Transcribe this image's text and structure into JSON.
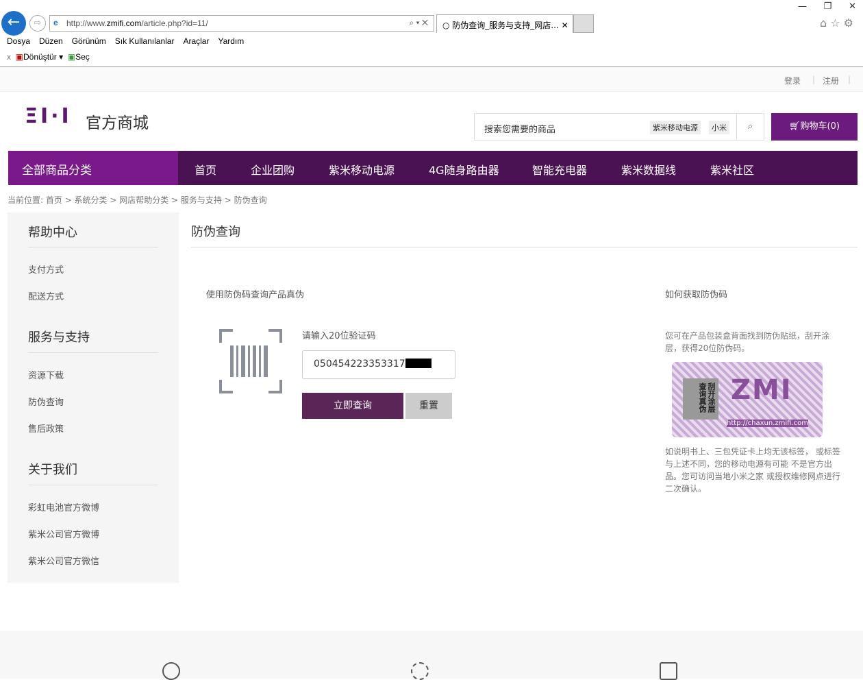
{
  "browser": {
    "url_prefix": "http://www.",
    "url_domain": "zmifi.com",
    "url_path": "/article.php?id=11/",
    "tab_title": "防伪查询_服务与支持_网店...",
    "menu": [
      "Dosya",
      "Düzen",
      "Görünüm",
      "Sık Kullanılanlar",
      "Araçlar",
      "Yardım"
    ],
    "toolbar": {
      "close": "x",
      "convert": "Dönüştür",
      "select": "Seç"
    }
  },
  "topbar": {
    "login": "登录",
    "register": "注册"
  },
  "header": {
    "logo": "ZMI",
    "logo_sub": "官方商城",
    "search_placeholder": "搜索您需要的商品",
    "keywords": [
      "紫米移动电源",
      "小米"
    ],
    "cart": "购物车(0)"
  },
  "nav": {
    "all": "全部商品分类",
    "items": [
      "首页",
      "企业团购",
      "紫米移动电源",
      "4G随身路由器",
      "智能充电器",
      "紫米数据线",
      "紫米社区"
    ]
  },
  "breadcrumb": "当前位置: 首页 > 系统分类 > 网店帮助分类 > 服务与支持 > 防伪查询",
  "sidebar": {
    "sections": [
      {
        "title": "帮助中心",
        "items": [
          "支付方式",
          "配送方式"
        ]
      },
      {
        "title": "服务与支持",
        "items": [
          "资源下载",
          "防伪查询",
          "售后政策"
        ]
      },
      {
        "title": "关于我们",
        "items": [
          "彩虹电池官方微博",
          "紫米公司官方微博",
          "紫米公司官方微信"
        ]
      }
    ]
  },
  "main": {
    "title": "防伪查询",
    "subtitle": "使用防伪码查询产品真伪",
    "input_label": "请输入20位验证码",
    "code_value": "050454223353317",
    "query_button": "立即查询",
    "reset_button": "重置"
  },
  "help": {
    "title": "如何获取防伪码",
    "intro": "您可在产品包装盒背面找到防伪贴纸，刮开涂层，获得20位防伪码。",
    "label_scratch": "刮开涂层查询真伪",
    "label_brand": "ZMI",
    "label_url": "http://chaxun.zmifi.com",
    "note": "如说明书上、三包凭证卡上均无该标签， 或标签与上述不同，您的移动电源有可能 不是官方出品。您可访问当地小米之家 或授权维修网点进行二次确认。"
  }
}
